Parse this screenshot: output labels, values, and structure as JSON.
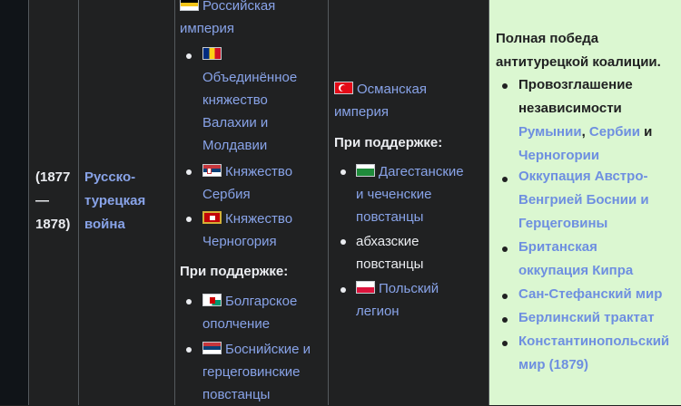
{
  "date": {
    "line1": "(1877",
    "line2": "—",
    "line3": "1878)"
  },
  "war": {
    "line1": "Русско-",
    "line2": "турецкая",
    "line3": "война"
  },
  "side1": {
    "main_line1": "Российская",
    "main_line2": "империя",
    "allies": [
      {
        "lines": [
          "Объединённое",
          "княжество",
          "Валахии и",
          "Молдавии"
        ],
        "flag": "wallachia-flag-icon"
      },
      {
        "lines": [
          "Княжество",
          "Сербия"
        ],
        "flag": "serbia-flag-icon"
      },
      {
        "lines": [
          "Княжество",
          "Черногория"
        ],
        "flag": "montenegro-flag-icon"
      }
    ],
    "support_heading": "При поддержке:",
    "supporters": [
      {
        "lines": [
          "Болгарское",
          "ополчение"
        ],
        "flag": "bulgarian-militia-flag-icon"
      },
      {
        "lines": [
          "Боснийские и",
          "герцеговинские",
          "повстанцы"
        ],
        "flag": "bosnian-flag-icon"
      }
    ]
  },
  "side2": {
    "main_line1": "Османская",
    "main_line2": "империя",
    "support_heading": "При поддержке:",
    "supporters": [
      {
        "lines": [
          "Дагестанские",
          "и чеченские",
          "повстанцы"
        ],
        "flag": "dagestan-flag-icon",
        "link": true
      },
      {
        "lines": [
          "абхазские",
          "повстанцы"
        ],
        "flag": "",
        "link": false
      },
      {
        "lines": [
          "Польский",
          "легион"
        ],
        "flag": "poland-flag-icon",
        "link": true
      }
    ]
  },
  "result": {
    "title_line1": "Полная победа",
    "title_line2": "антитурецкой коалиции.",
    "independence_line1": "Провозглашение",
    "independence_line2": "независимости",
    "romania": "Румынии",
    "comma": ",",
    "serbia": "Сербии",
    "and": "и",
    "montenegro": "Черногории",
    "items": [
      {
        "lines": [
          "Оккупация Австро-",
          "Венгрией Боснии и",
          "Герцеговины"
        ]
      },
      {
        "lines": [
          "Британская",
          "оккупация Кипра"
        ]
      },
      {
        "lines": [
          "Сан-Стефанский мир"
        ]
      },
      {
        "lines": [
          "Берлинский трактат"
        ]
      },
      {
        "lines": [
          "Константинопольский",
          "мир (1879)"
        ]
      }
    ]
  }
}
